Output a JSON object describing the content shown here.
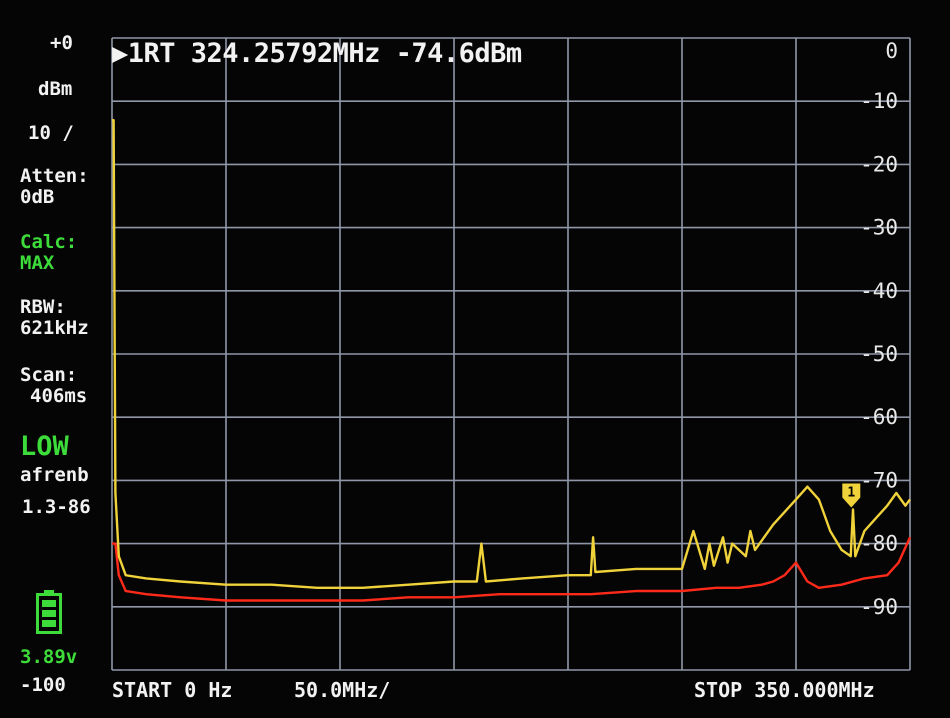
{
  "side_panel": {
    "ref_level": "+0",
    "unit": "dBm",
    "scale": "10 /",
    "atten_label": "Atten:",
    "atten_value": "0dB",
    "calc_label": "Calc:",
    "calc_value": "MAX",
    "rbw_label": "RBW:",
    "rbw_value": "621kHz",
    "scan_label": "Scan:",
    "scan_value": "406ms",
    "mode": "LOW",
    "mode_sub": "afrenb",
    "version": "1.3-86",
    "battery_voltage": "3.89v",
    "bottom_level": "-100"
  },
  "marker": {
    "readout": "▶1RT 324.25792MHz -74.6dBm",
    "tag": "1"
  },
  "footer": {
    "start": "START 0 Hz",
    "per_div": "50.0MHz/",
    "stop": "STOP 350.000MHz"
  },
  "colors": {
    "trace_max": "#f0d23a",
    "trace_actual": "#ff2a1a",
    "grid": "#8f97a8",
    "accent_green": "#3ddc3a"
  },
  "chart_data": {
    "type": "line",
    "xlim": [
      0,
      350
    ],
    "ylim": [
      -100,
      0
    ],
    "y_tick_labels": [
      "0",
      "-10",
      "-20",
      "-30",
      "-40",
      "-50",
      "-60",
      "-70",
      "-80",
      "-90"
    ],
    "grid": true,
    "marker": {
      "x": 324.25792,
      "y": -74.6
    },
    "series": [
      {
        "color": "#f0d23a",
        "x": [
          0,
          0.7,
          1.5,
          3,
          6,
          15,
          30,
          50,
          70,
          90,
          110,
          130,
          150,
          160,
          162,
          164,
          180,
          200,
          210,
          211,
          212,
          230,
          240,
          250,
          255,
          260,
          262,
          264,
          268,
          270,
          272,
          278,
          280,
          282,
          290,
          300,
          305,
          310,
          312,
          315,
          320,
          324,
          325,
          326,
          330,
          335,
          340,
          344,
          348,
          350
        ],
        "y": [
          -13,
          -13,
          -72,
          -82,
          -85,
          -85.5,
          -86,
          -86.5,
          -86.5,
          -87,
          -87,
          -86.5,
          -86,
          -86,
          -80,
          -86,
          -85.5,
          -85,
          -85,
          -79,
          -84.5,
          -84,
          -84,
          -84,
          -78,
          -84,
          -80,
          -83.5,
          -79,
          -83,
          -80,
          -82,
          -78,
          -81,
          -77,
          -73,
          -71,
          -73,
          -75,
          -78,
          -81,
          -82,
          -74.6,
          -82,
          -78,
          -76,
          -74,
          -72,
          -74,
          -73
        ]
      },
      {
        "color": "#ff2a1a",
        "x": [
          0,
          1.5,
          3,
          6,
          15,
          30,
          50,
          70,
          90,
          110,
          130,
          150,
          170,
          190,
          210,
          230,
          250,
          265,
          275,
          285,
          290,
          295,
          300,
          305,
          310,
          320,
          330,
          340,
          345,
          350
        ],
        "y": [
          -80,
          -80,
          -85,
          -87.5,
          -88,
          -88.5,
          -89,
          -89,
          -89,
          -89,
          -88.5,
          -88.5,
          -88,
          -88,
          -88,
          -87.5,
          -87.5,
          -87,
          -87,
          -86.5,
          -86,
          -85,
          -83,
          -86,
          -87,
          -86.5,
          -85.5,
          -85,
          -83,
          -79
        ]
      }
    ]
  }
}
